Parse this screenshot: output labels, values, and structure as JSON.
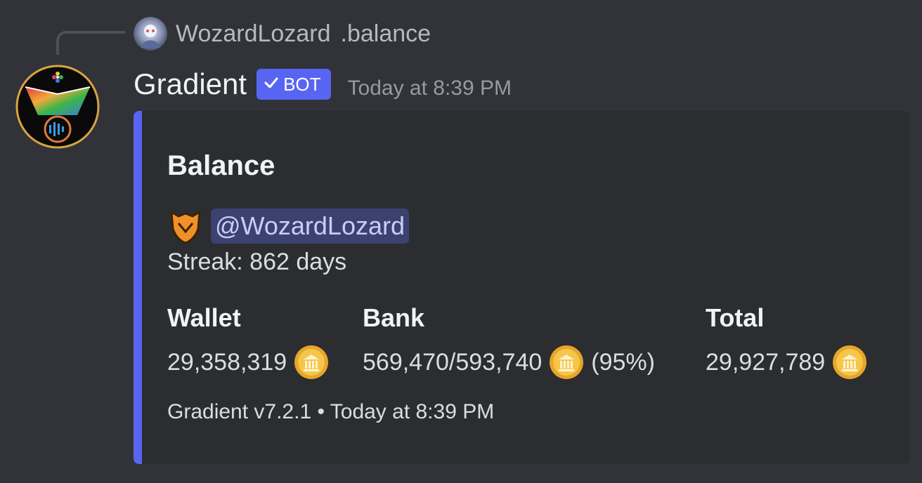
{
  "reply": {
    "author": "WozardLozard",
    "text": ".balance"
  },
  "message": {
    "author": "Gradient",
    "bot_badge": "BOT",
    "timestamp": "Today at 8:39 PM"
  },
  "embed": {
    "accent_color": "#5865f2",
    "title": "Balance",
    "mention": "@WozardLozard",
    "streak": "Streak: 862 days",
    "fields": {
      "wallet": {
        "name": "Wallet",
        "value": "29,358,319"
      },
      "bank": {
        "name": "Bank",
        "value": "569,470/593,740",
        "percent": "(95%)"
      },
      "total": {
        "name": "Total",
        "value": "29,927,789"
      }
    },
    "footer": "Gradient v7.2.1 • Today at 8:39 PM"
  },
  "icons": {
    "check": "check-icon",
    "coin": "bank-coin-icon",
    "shield": "shield-emoji-icon"
  }
}
